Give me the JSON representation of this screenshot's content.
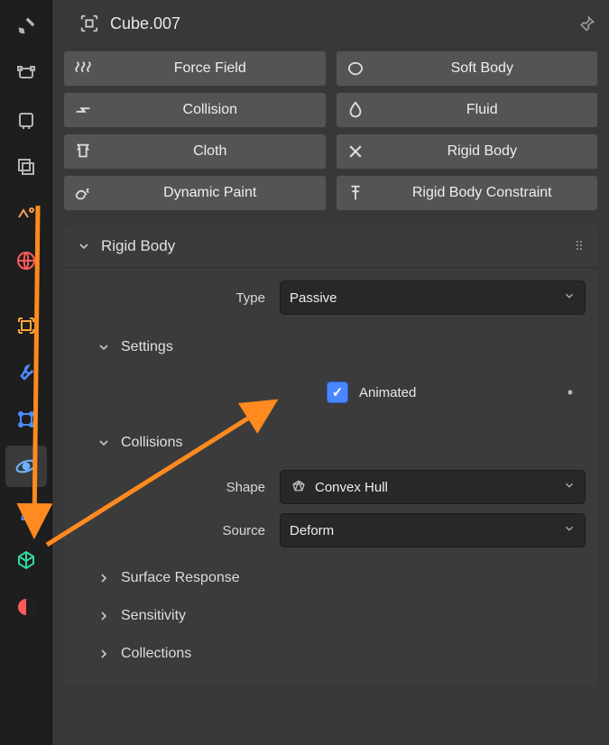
{
  "header": {
    "object_name": "Cube.007"
  },
  "physics": [
    [
      {
        "id": "force-field",
        "label": "Force Field"
      },
      {
        "id": "collision",
        "label": "Collision"
      },
      {
        "id": "cloth",
        "label": "Cloth"
      },
      {
        "id": "dynamic-paint",
        "label": "Dynamic Paint"
      }
    ],
    [
      {
        "id": "soft-body",
        "label": "Soft Body"
      },
      {
        "id": "fluid",
        "label": "Fluid"
      },
      {
        "id": "rigid-body",
        "label": "Rigid Body"
      },
      {
        "id": "rigid-body-constraint",
        "label": "Rigid Body Constraint"
      }
    ]
  ],
  "rigid_body": {
    "panel_title": "Rigid Body",
    "type_label": "Type",
    "type_value": "Passive",
    "settings_title": "Settings",
    "animated_label": "Animated",
    "animated_checked": true,
    "collisions_title": "Collisions",
    "shape_label": "Shape",
    "shape_value": "Convex Hull",
    "source_label": "Source",
    "source_value": "Deform",
    "subpanels": [
      "Surface Response",
      "Sensitivity",
      "Collections"
    ]
  },
  "sidebar_icons": [
    "tool",
    "render",
    "output",
    "viewlayer",
    "scene",
    "world",
    "divider",
    "object",
    "modifier",
    "particle",
    "physics",
    "constraint",
    "data",
    "material"
  ]
}
